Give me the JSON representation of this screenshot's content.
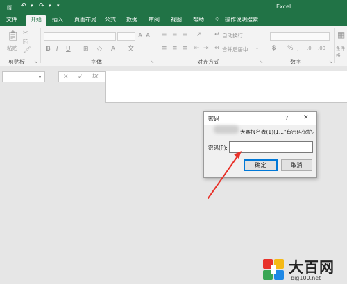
{
  "app_title": "Excel",
  "tabs": [
    "文件",
    "开始",
    "插入",
    "页面布局",
    "公式",
    "数据",
    "审阅",
    "视图",
    "帮助"
  ],
  "tell_me": "操作说明搜索",
  "ribbon": {
    "groups": [
      "剪贴板",
      "字体",
      "对齐方式",
      "数字"
    ],
    "paste_label": "粘贴",
    "wrap_text": "自动换行",
    "merge_center": "合并后居中",
    "condition": "条件格"
  },
  "formula_bar": {
    "cancel": "✕",
    "confirm": "✓",
    "fx": "fx"
  },
  "dialog": {
    "title": "密码",
    "help": "?",
    "close": "✕",
    "message": "大赛报名表(1)(1...\"有密码保护。",
    "password_label": "密码(P):",
    "password_value": "",
    "ok": "确定",
    "cancel": "取消"
  },
  "watermark": {
    "brand": "大百网",
    "url": "big100.net"
  },
  "colors": {
    "excel_green": "#217346",
    "arrow_red": "#e8322a",
    "accent_blue": "#0078d7"
  }
}
